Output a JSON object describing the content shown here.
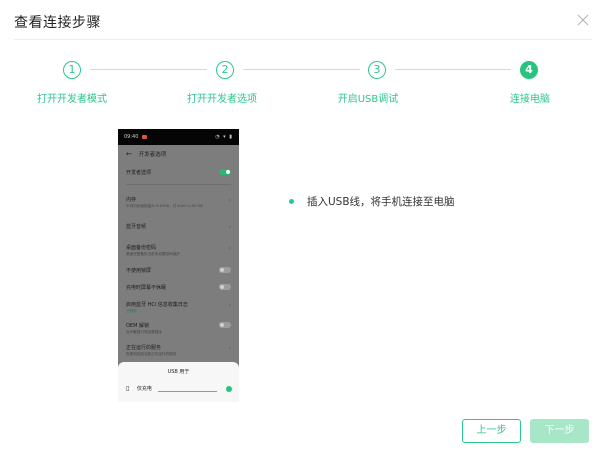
{
  "dialog": {
    "title": "查看连接步骤",
    "close_icon": "close-icon"
  },
  "steps": [
    {
      "number": "1",
      "label": "打开开发者模式",
      "active": false
    },
    {
      "number": "2",
      "label": "打开开发者选项",
      "active": false
    },
    {
      "number": "3",
      "label": "开启USB调试",
      "active": false
    },
    {
      "number": "4",
      "label": "连接电脑",
      "active": true
    }
  ],
  "colors": {
    "accent": "#2bc88b",
    "accent_active": "#27c47f",
    "disabled_button": "#a8e6c8"
  },
  "phone": {
    "status_time": "09:40",
    "status_icons": "◔ ▾ ▮",
    "header_title": "开发者选项",
    "rows": [
      {
        "title": "开发者选项",
        "sub": "",
        "control": "toggle-on"
      },
      {
        "title": "内存",
        "sub": "平均内存使用量为 4.40GB，共 6.00+2.00 GB",
        "control": "chevron"
      },
      {
        "title": "蓝牙音频",
        "sub": "",
        "control": "chevron"
      },
      {
        "title": "桌面备份密码",
        "sub": "桌面完整备份当前未设置密码保护",
        "control": "chevron"
      },
      {
        "title": "不使用锁屏",
        "sub": "",
        "control": "toggle-off"
      },
      {
        "title": "充电时屏幕不休眠",
        "sub": "",
        "control": "toggle-off"
      },
      {
        "title": "启用蓝牙 HCI 信息收集日志",
        "sub": "已停用",
        "control": "chevron"
      },
      {
        "title": "OEM 解锁",
        "sub": "允许解锁引导加载程序",
        "control": "toggle-off"
      },
      {
        "title": "正在运行的服务",
        "sub": "查看和控制当前正在运行的服务",
        "control": "chevron"
      }
    ],
    "usb_sheet": {
      "title": "USB 用于",
      "option": "仅充电"
    }
  },
  "instruction": "插入USB线，将手机连接至电脑",
  "footer": {
    "prev_label": "上一步",
    "next_label": "下一步"
  }
}
